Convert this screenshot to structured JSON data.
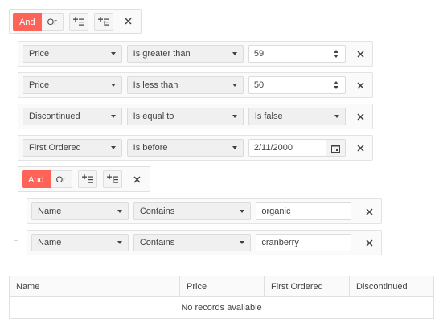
{
  "root_group": {
    "logic": {
      "and_label": "And",
      "or_label": "Or",
      "active": "And"
    },
    "tools": [
      "add-expression-icon",
      "add-group-icon",
      "close-icon"
    ]
  },
  "expressions": [
    {
      "field": "Price",
      "operator": "Is greater than",
      "value": "59",
      "editor": "numeric"
    },
    {
      "field": "Price",
      "operator": "Is less than",
      "value": "50",
      "editor": "numeric"
    },
    {
      "field": "Discontinued",
      "operator": "Is equal to",
      "value": "Is false",
      "editor": "dropdown"
    },
    {
      "field": "First Ordered",
      "operator": "Is before",
      "value": "2/11/2000",
      "editor": "date"
    }
  ],
  "nested_group": {
    "logic": {
      "and_label": "And",
      "or_label": "Or",
      "active": "And"
    },
    "expressions": [
      {
        "field": "Name",
        "operator": "Contains",
        "value": "organic",
        "editor": "text"
      },
      {
        "field": "Name",
        "operator": "Contains",
        "value": "cranberry",
        "editor": "text"
      }
    ]
  },
  "grid": {
    "columns": [
      "Name",
      "Price",
      "First Ordered",
      "Discontinued"
    ],
    "empty_message": "No records available"
  },
  "colors": {
    "accent": "#ff6358",
    "border": "#e0e0e0",
    "panel": "#fafafa"
  }
}
